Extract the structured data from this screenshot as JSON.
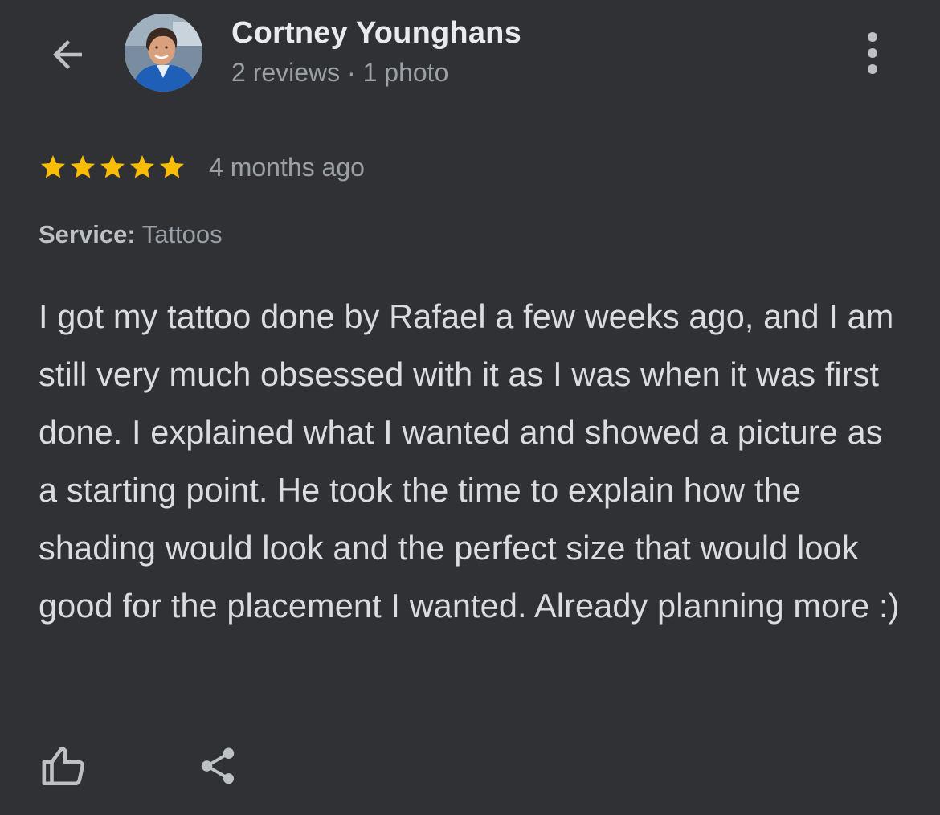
{
  "header": {
    "author_name": "Cortney Younghans",
    "author_meta": "2 reviews · 1 photo",
    "back_icon": "arrow-left-icon",
    "more_icon": "more-vert-icon"
  },
  "review": {
    "rating": 5,
    "rating_max": 5,
    "time_ago": "4 months ago",
    "service_label": "Service:",
    "service_value": "Tattoos",
    "text": "I got my tattoo done by Rafael a few weeks ago, and I am still very much obsessed with it as I was when it was first done. I explained what I wanted and showed a picture as a starting point. He took the time to explain how the shading would look and the perfect size that would look good for the placement I wanted. Already planning more :)"
  },
  "actions": {
    "like_icon": "thumbs-up-icon",
    "share_icon": "share-icon"
  },
  "colors": {
    "background": "#303134",
    "star": "#fbbc04",
    "primary_text": "#e8eaed",
    "secondary_text": "#9aa0a6"
  }
}
